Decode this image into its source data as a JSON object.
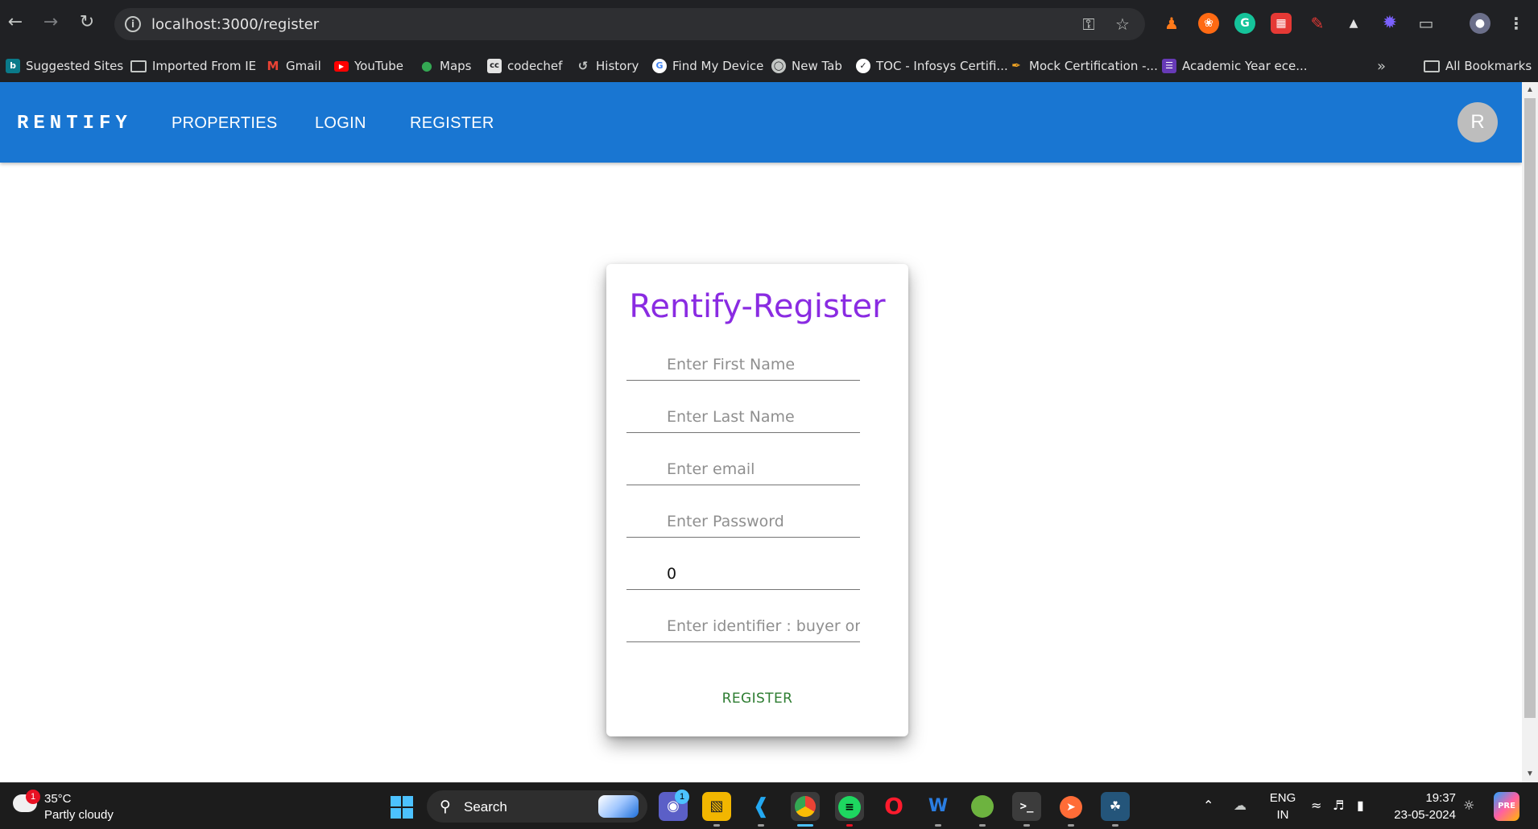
{
  "browser": {
    "url": "localhost:3000/register",
    "bookmarks": [
      {
        "label": "Suggested Sites",
        "icon": "bing-icon"
      },
      {
        "label": "Imported From IE",
        "icon": "folder-icon"
      },
      {
        "label": "Gmail",
        "icon": "gmail-icon"
      },
      {
        "label": "YouTube",
        "icon": "youtube-icon"
      },
      {
        "label": "Maps",
        "icon": "maps-icon"
      },
      {
        "label": "codechef",
        "icon": "codechef-icon"
      },
      {
        "label": "History",
        "icon": "history-icon"
      },
      {
        "label": "Find My Device",
        "icon": "google-icon"
      },
      {
        "label": "New Tab",
        "icon": "globe-icon"
      },
      {
        "label": "TOC - Infosys Certifi...",
        "icon": "infosys-icon"
      },
      {
        "label": "Mock Certification -...",
        "icon": "mock-icon"
      },
      {
        "label": "Academic Year ece...",
        "icon": "forms-icon"
      }
    ],
    "all_bookmarks": "All Bookmarks"
  },
  "appbar": {
    "brand": "RENTIFY",
    "nav": [
      "PROPERTIES",
      "LOGIN",
      "REGISTER"
    ],
    "avatar_letter": "R",
    "color": "#1976d2"
  },
  "form": {
    "title": "Rentify-Register",
    "title_color": "#8a2be2",
    "fields": [
      {
        "placeholder": "Enter First Name",
        "value": ""
      },
      {
        "placeholder": "Enter Last Name",
        "value": ""
      },
      {
        "placeholder": "Enter email",
        "value": ""
      },
      {
        "placeholder": "Enter Password",
        "value": ""
      },
      {
        "placeholder": "",
        "value": "0"
      },
      {
        "placeholder": "Enter identifier : buyer or seller",
        "value": ""
      }
    ],
    "submit_label": "REGISTER",
    "submit_color": "#2e7d32"
  },
  "taskbar": {
    "weather_temp": "35°C",
    "weather_desc": "Partly cloudy",
    "weather_badge": "1",
    "search_label": "Search",
    "chat_badge": "1",
    "lang_1": "ENG",
    "lang_2": "IN",
    "time": "19:37",
    "date": "23-05-2024"
  }
}
